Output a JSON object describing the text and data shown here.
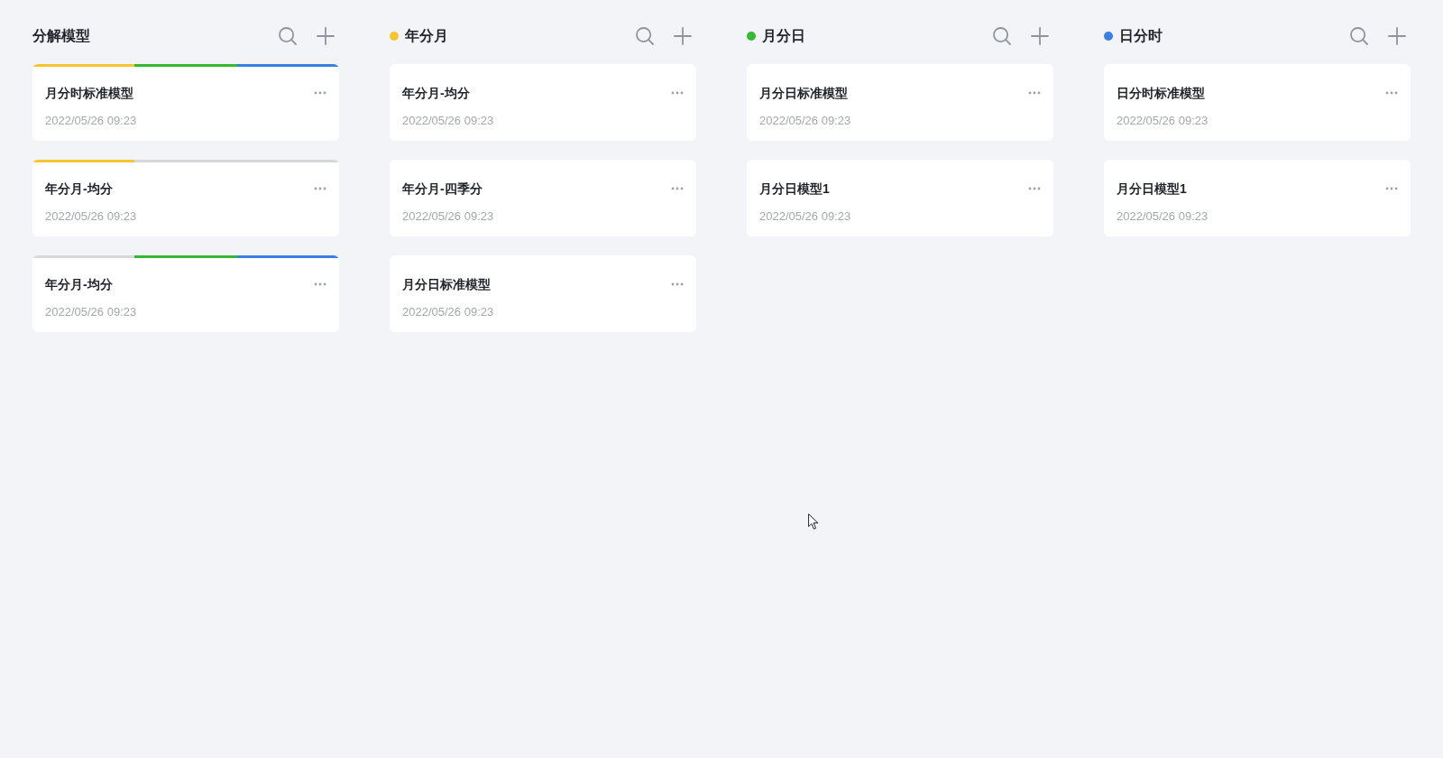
{
  "columns": [
    {
      "title": "分解模型",
      "cards": [
        {
          "title": "月分时标准模型",
          "time": "2022/05/26 09:23",
          "segments": [
            {
              "color": "#f7c52f",
              "active": true
            },
            {
              "color": "#35b932",
              "active": true
            },
            {
              "color": "#3a7fe3",
              "active": true
            }
          ]
        },
        {
          "title": "年分月-均分",
          "time": "2022/05/26 09:23",
          "segments": [
            {
              "color": "#f7c52f",
              "active": true
            },
            {
              "active": false
            },
            {
              "active": false
            }
          ]
        },
        {
          "title": "年分月-均分",
          "time": "2022/05/26 09:23",
          "segments": [
            {
              "active": false
            },
            {
              "color": "#35b932",
              "active": true
            },
            {
              "color": "#3a7fe3",
              "active": true
            }
          ]
        }
      ]
    },
    {
      "title": "年分月",
      "color": "#f7c52f",
      "cards": [
        {
          "title": "年分月-均分",
          "time": "2022/05/26 09:23"
        },
        {
          "title": "年分月-四季分",
          "time": "2022/05/26 09:23"
        },
        {
          "title": "月分日标准模型",
          "time": "2022/05/26 09:23"
        }
      ]
    },
    {
      "title": "月分日",
      "color": "#35b932",
      "cards": [
        {
          "title": "月分日标准模型",
          "time": "2022/05/26 09:23"
        },
        {
          "title": "月分日模型1",
          "time": "2022/05/26 09:23"
        }
      ]
    },
    {
      "title": "日分时",
      "color": "#3a7fe3",
      "cards": [
        {
          "title": "日分时标准模型",
          "time": "2022/05/26 09:23"
        },
        {
          "title": "月分日模型1",
          "time": "2022/05/26 09:23"
        }
      ]
    }
  ]
}
